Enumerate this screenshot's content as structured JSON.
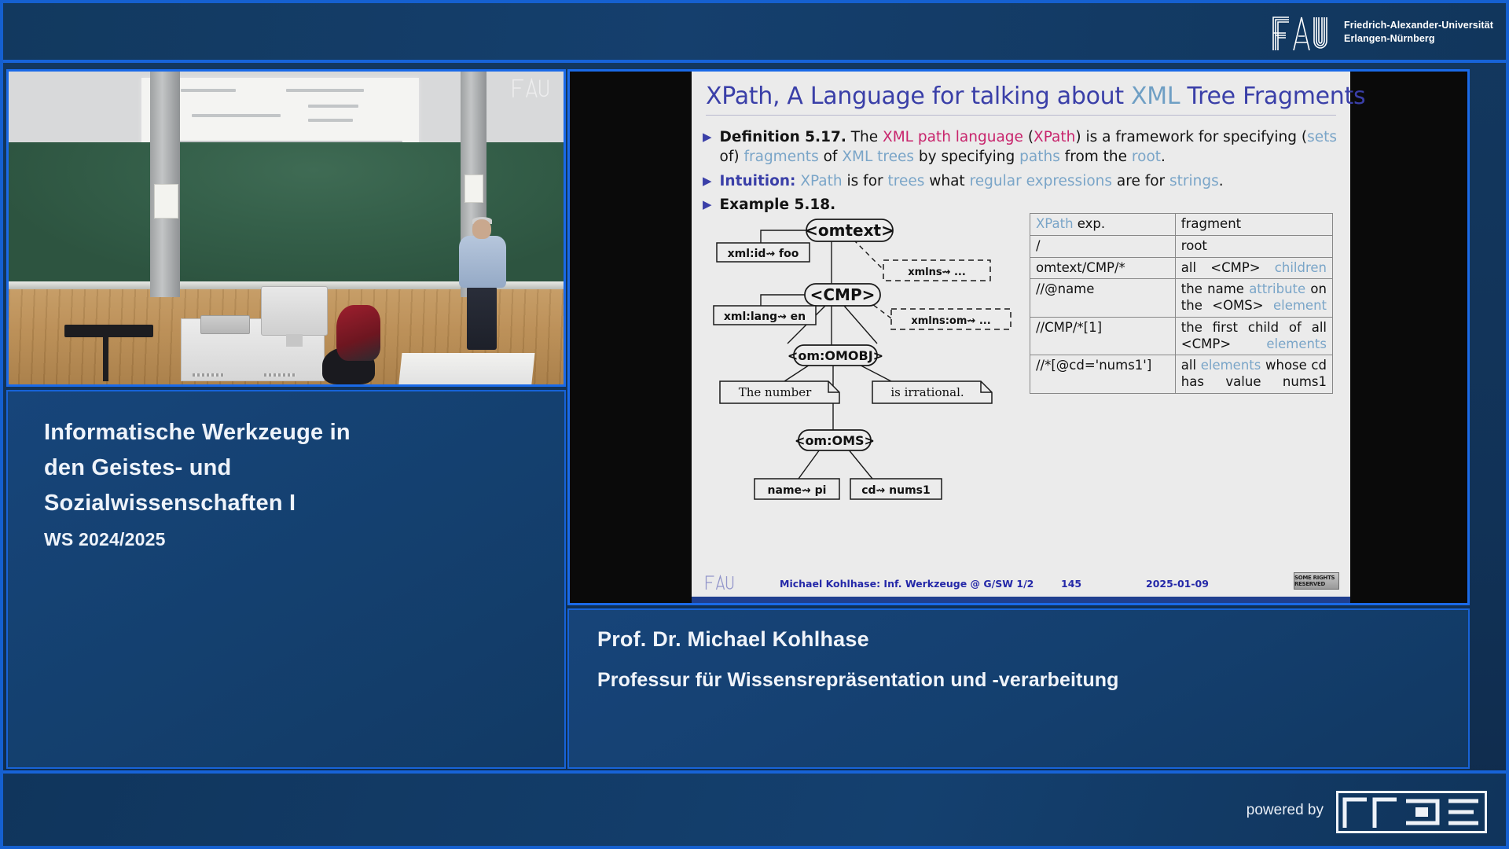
{
  "header": {
    "logo_icon": "fau-logo",
    "university_line1": "Friedrich-Alexander-Universität",
    "university_line2": "Erlangen-Nürnberg"
  },
  "video": {
    "watermark": "FAU",
    "scene_description": "lecture hall with presenter at blackboard"
  },
  "course": {
    "title_line1": "Informatische Werkzeuge in",
    "title_line2": "den Geistes- und",
    "title_line3": "Sozialwissenschaften I",
    "term": "WS 2024/2025"
  },
  "speaker": {
    "name": "Prof. Dr. Michael Kohlhase",
    "chair": "Professur für Wissensrepräsentation und -verarbeitung"
  },
  "slide": {
    "title_part1": "XPath, A Language for talking about ",
    "title_xml": "XML",
    "title_part2": " Tree Fragments",
    "bullets": [
      {
        "marker": "▶",
        "lead": "Definition 5.17.",
        "text": "The XML path language (XPath) is a framework for specifying (sets of) fragments of XML trees by specifying paths from the root."
      },
      {
        "marker": "▶",
        "lead": "Intuition:",
        "text": "XPath is for trees what regular expressions are for strings."
      },
      {
        "marker": "▶",
        "lead": "Example 5.18.",
        "text": ""
      }
    ],
    "tree": {
      "root": "<omtext>",
      "root_attr": "xml:id⇝ foo",
      "root_ns": "xmlns⇝ ...",
      "cmp": "<CMP>",
      "cmp_attr": "xml:lang⇝ en",
      "cmp_ns": "xmlns:om⇝ ...",
      "omobj": "<om:OMOBJ>",
      "text_left": "The number",
      "text_right": "is irrational.",
      "oms": "<om:OMS>",
      "oms_attr1": "name⇝ pi",
      "oms_attr2": "cd⇝ nums1"
    },
    "table": {
      "header": [
        "XPath exp.",
        "fragment"
      ],
      "rows": [
        {
          "expr": "/",
          "frag_plain": "root",
          "frag_blue": ""
        },
        {
          "expr": "omtext/CMP/*",
          "frag_plain": "all <CMP>",
          "frag_blue": "children"
        },
        {
          "expr": "//@name",
          "frag_plain": "the name ",
          "frag_blue": "attribute",
          "frag_plain2": " on the <OMS> ",
          "frag_blue2": "element"
        },
        {
          "expr": "//CMP/*[1]",
          "frag_plain": "the first child of all <CMP> ",
          "frag_blue": "elements"
        },
        {
          "expr": "//*[@cd='nums1']",
          "frag_plain": "all ",
          "frag_blue": "elements",
          "frag_plain2": " whose cd has value nums1"
        }
      ]
    },
    "footer": {
      "logo": "FAU",
      "citation": "Michael Kohlhase: Inf. Werkzeuge @ G/SW  1/2",
      "page": "145",
      "date": "2025-01-09",
      "license": "SOME RIGHTS RESERVED"
    }
  },
  "page_footer": {
    "powered_by": "powered by",
    "logo_icon": "rrze-logo"
  },
  "colors": {
    "accent_blue": "#1763d8",
    "panel_blue": "#14406f",
    "header_blue": "#12395f",
    "slide_bg": "#ebebeb",
    "title_navy": "#3a3fa8",
    "link_blue": "#7aa5c8",
    "highlight_pink": "#c8246c"
  }
}
